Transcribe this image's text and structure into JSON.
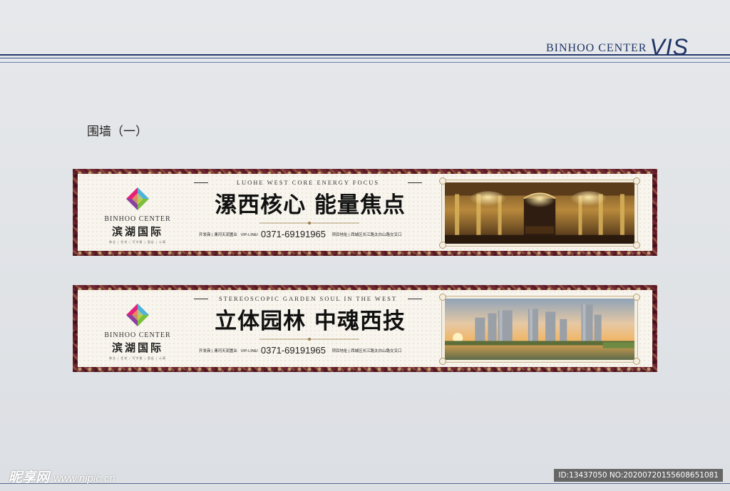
{
  "header": {
    "brand": "BINHOO CENTER",
    "vis": "VIS"
  },
  "section_title": "围墙（一）",
  "banners": [
    {
      "logo_en": "BINHOO CENTER",
      "logo_cn": "滨湖国际",
      "logo_sub": "商业 | 住宅 | 写字楼 | 酒店 | 公寓",
      "tagline_en": "LUOHE WEST CORE ENERGY FOCUS",
      "headline": "漯西核心  能量焦点",
      "developer": "开发商 | 漯河天润置业",
      "vip_label": "VIP-LINE/",
      "phone": "0371-69191965",
      "address": "项目地址 | 西城区长江路太白山路交叉口"
    },
    {
      "logo_en": "BINHOO CENTER",
      "logo_cn": "滨湖国际",
      "logo_sub": "商业 | 住宅 | 写字楼 | 酒店 | 公寓",
      "tagline_en": "STEREOSCOPIC GARDEN SOUL IN THE WEST",
      "headline": "立体园林  中魂西技",
      "developer": "开发商 | 漯河天润置业",
      "vip_label": "VIP-LINE/",
      "phone": "0371-69191965",
      "address": "项目地址 | 西城区长江路太白山路交叉口"
    }
  ],
  "watermark": {
    "left": "昵享网",
    "url": "www.nipic.cn",
    "right": "ID:13437050 NO:20200720155608651081"
  },
  "colors": {
    "navy": "#1f3466",
    "maroon": "#6e2631",
    "cream": "#f8f5ee"
  }
}
